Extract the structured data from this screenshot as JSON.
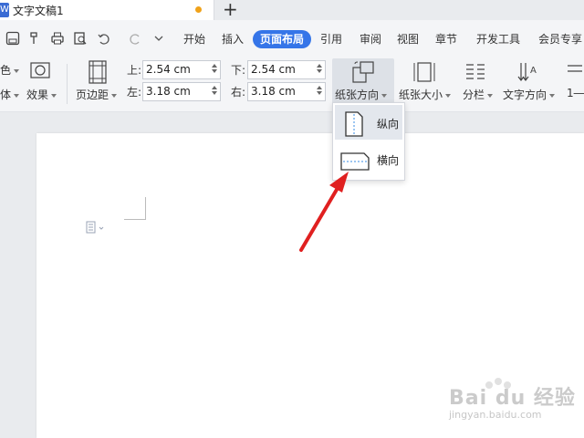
{
  "tab": {
    "title": "文字文稿1",
    "app_badge": "W"
  },
  "quick_access": [
    "save-icon",
    "format-painter-icon",
    "print-icon",
    "print-preview-icon",
    "undo-icon",
    "redo-icon",
    "more-icon"
  ],
  "menu": {
    "tabs": [
      "开始",
      "插入",
      "页面布局",
      "引用",
      "审阅",
      "视图",
      "章节",
      "开发工具",
      "会员专享"
    ],
    "active": "页面布局"
  },
  "ribbon": {
    "theme_color_label": "色",
    "theme_font_label": "体",
    "effects_label": "效果",
    "margins_label": "页边距",
    "margin_top_label": "上:",
    "margin_top_value": "2.54 cm",
    "margin_bottom_label": "下:",
    "margin_bottom_value": "2.54 cm",
    "margin_left_label": "左:",
    "margin_left_value": "3.18 cm",
    "margin_right_label": "右:",
    "margin_right_value": "3.18 cm",
    "orientation_label": "纸张方向",
    "paper_size_label": "纸张大小",
    "columns_label": "分栏",
    "text_direction_label": "文字方向",
    "line_numbers_label": "1―"
  },
  "orientation_menu": {
    "items": [
      {
        "label": "纵向",
        "icon": "portrait-icon",
        "selected": true
      },
      {
        "label": "横向",
        "icon": "landscape-icon",
        "selected": false
      }
    ]
  },
  "watermark": {
    "text": "Bai du 经验",
    "sub": "jingyan.baidu.com"
  },
  "colors": {
    "accent": "#3575e8",
    "arrow": "#e02020",
    "doc_icon": "#3b6cd4",
    "unsaved_dot": "#f0a21a"
  }
}
